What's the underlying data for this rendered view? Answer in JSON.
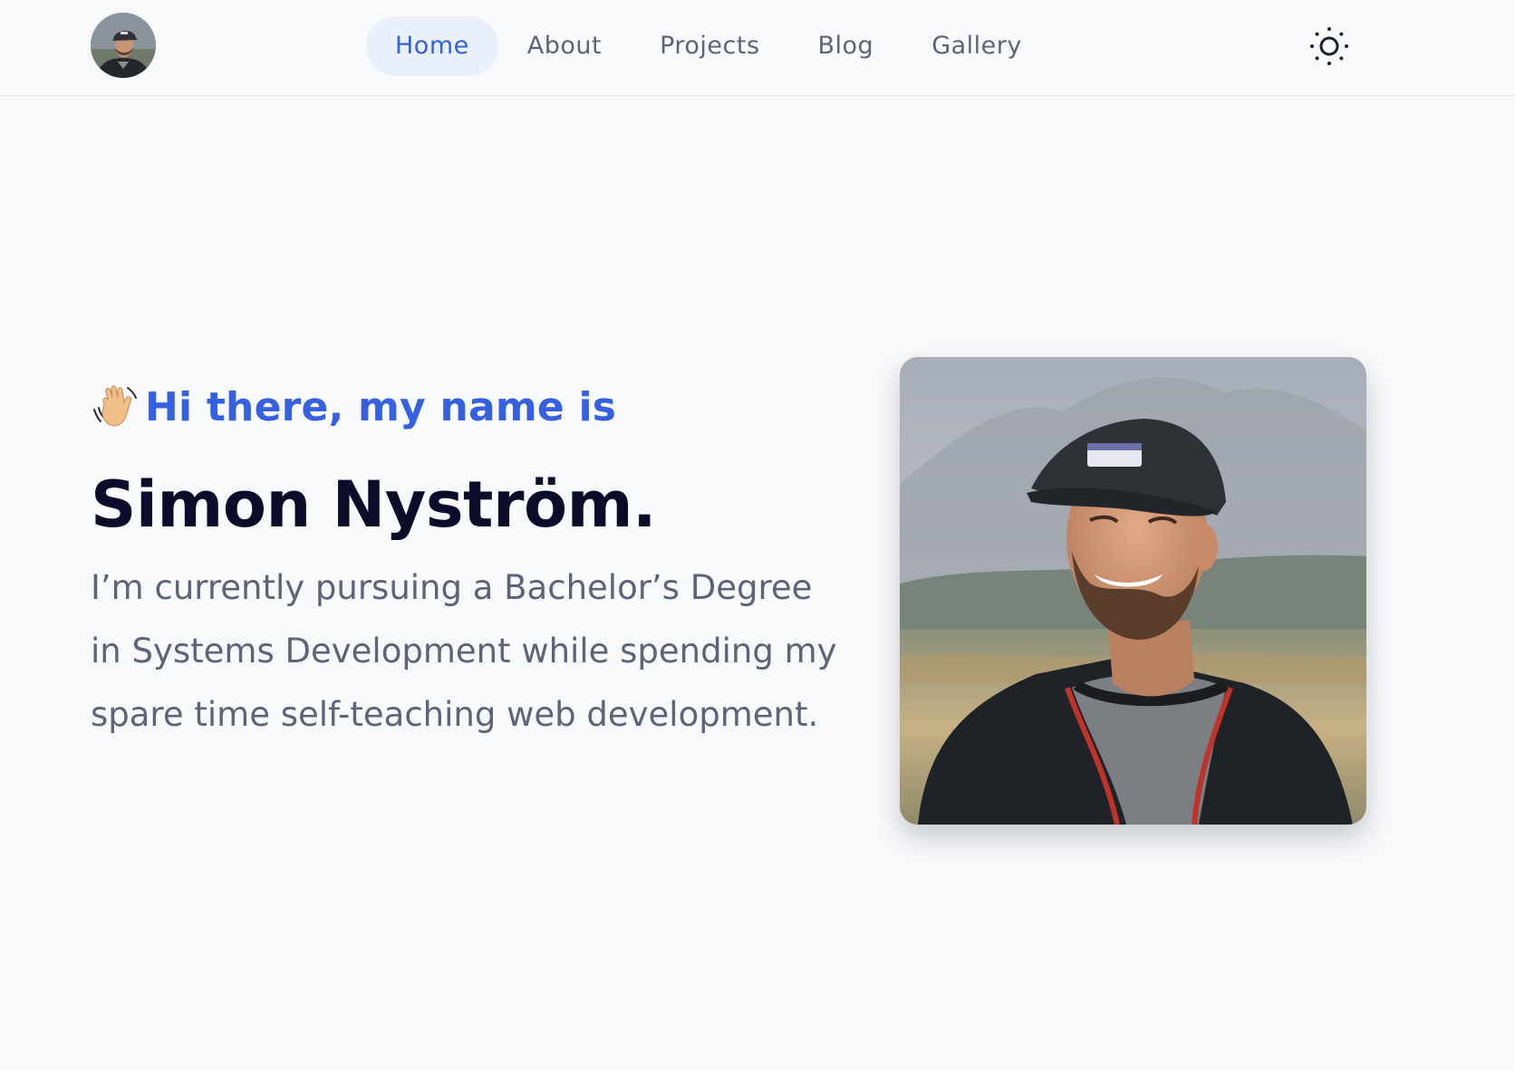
{
  "nav": {
    "items": [
      {
        "label": "Home",
        "active": true
      },
      {
        "label": "About",
        "active": false
      },
      {
        "label": "Projects",
        "active": false
      },
      {
        "label": "Blog",
        "active": false
      },
      {
        "label": "Gallery",
        "active": false
      }
    ],
    "avatar_icon": "profile-avatar",
    "theme_icon": "sun-icon"
  },
  "hero": {
    "wave_icon": "waving-hand-icon",
    "greeting": "Hi there, my name is",
    "name": "Simon Nyström.",
    "bio": "I’m currently pursuing a Bachelor’s Degree in Systems Development while spending my spare time self-teaching web development.",
    "portrait_icon": "profile-photo"
  },
  "colors": {
    "accent": "#3560e0",
    "heading": "#0b0b2a",
    "body_text": "#5d6478",
    "background": "#f8f9fb",
    "active_pill": "#eaf0fb"
  }
}
